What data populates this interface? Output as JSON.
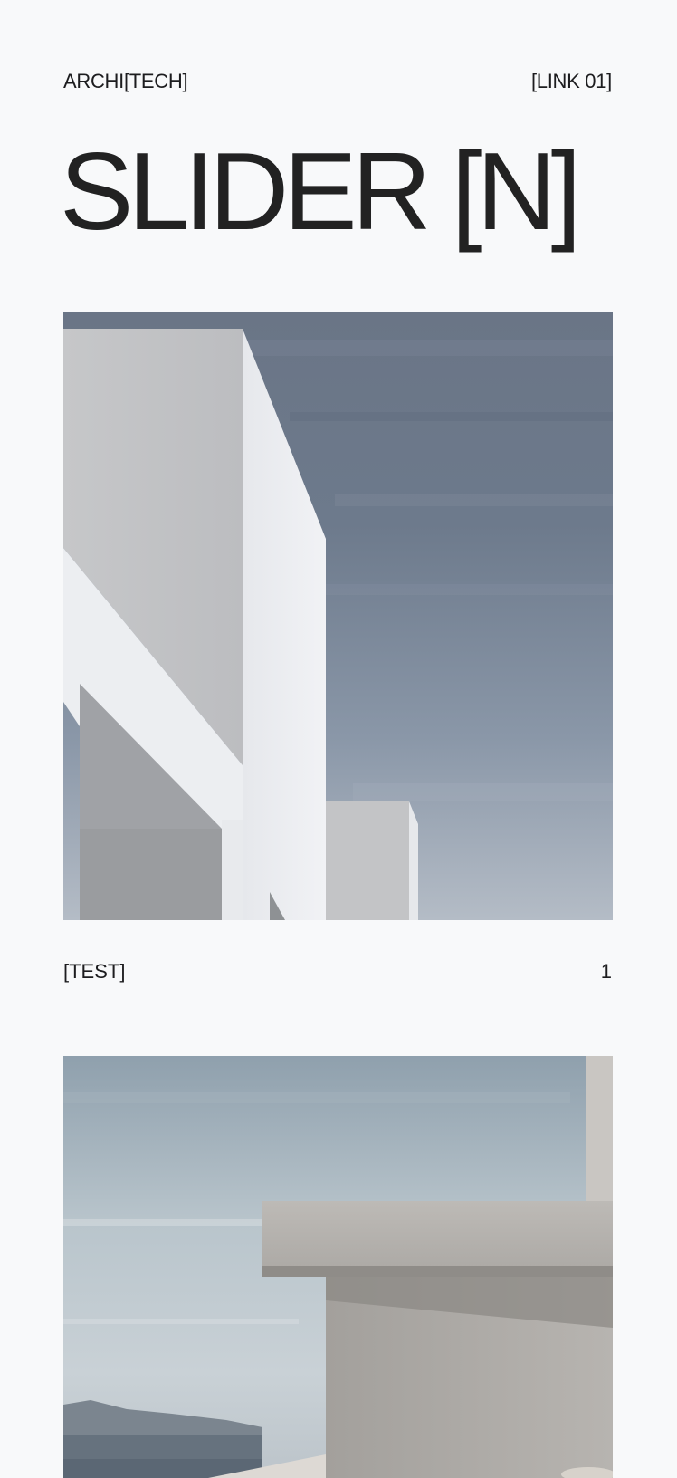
{
  "header": {
    "brand": "ARCHI[TECH]",
    "link": "[LINK 01]"
  },
  "page": {
    "title": "SLIDER [N]"
  },
  "slides": [
    {
      "caption": "[TEST]",
      "index": "1"
    }
  ],
  "colors": {
    "background": "#f8f9fa",
    "text": "#1d1d1f"
  }
}
